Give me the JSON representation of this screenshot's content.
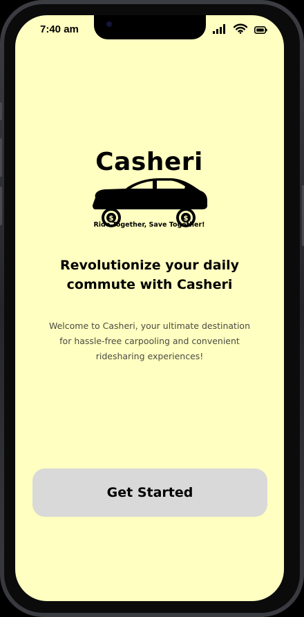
{
  "status_bar": {
    "time": "7:40 am",
    "icons": [
      "signal-icon",
      "wifi-icon",
      "battery-icon"
    ]
  },
  "logo": {
    "wordmark": "Casheri",
    "tagline": "Ride Together, Save Together!",
    "icon": "car-icon",
    "wheel_icon": "dollar-coin-icon"
  },
  "headline": "Revolutionize your daily commute with Casheri",
  "description": "Welcome to Casheri, your ultimate destination for hassle-free carpooling and convenient ridesharing experiences!",
  "cta": {
    "label": "Get Started"
  },
  "colors": {
    "screen_background": "#ffffc1",
    "button_background": "#d9d9d9",
    "text_primary": "#000000",
    "text_secondary": "#4a4a42"
  }
}
